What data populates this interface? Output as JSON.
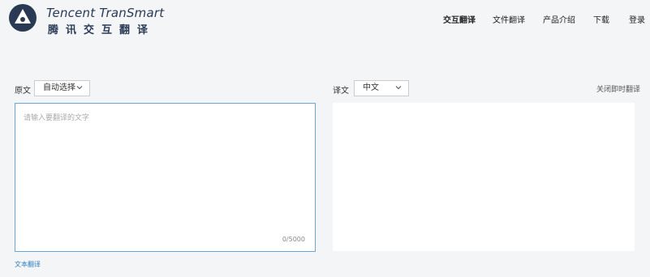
{
  "logo": {
    "en": "Tencent TranSmart",
    "cn": "腾讯交互翻译"
  },
  "nav": {
    "items": [
      "交互翻译",
      "文件翻译",
      "产品介绍",
      "下载",
      "登录"
    ]
  },
  "source": {
    "label": "原文",
    "language": "自动选择",
    "placeholder": "请输入要翻译的文字",
    "value": "",
    "counter": "0/5000"
  },
  "target": {
    "label": "译文",
    "language": "中文",
    "value": ""
  },
  "toggle_instant": "关闭即时翻译",
  "mode_link": "文本翻译",
  "colors": {
    "brand": "#2a3a55",
    "link": "#2f7fc1",
    "focus_border": "#6aa6d6",
    "background": "#f4f5f7"
  }
}
